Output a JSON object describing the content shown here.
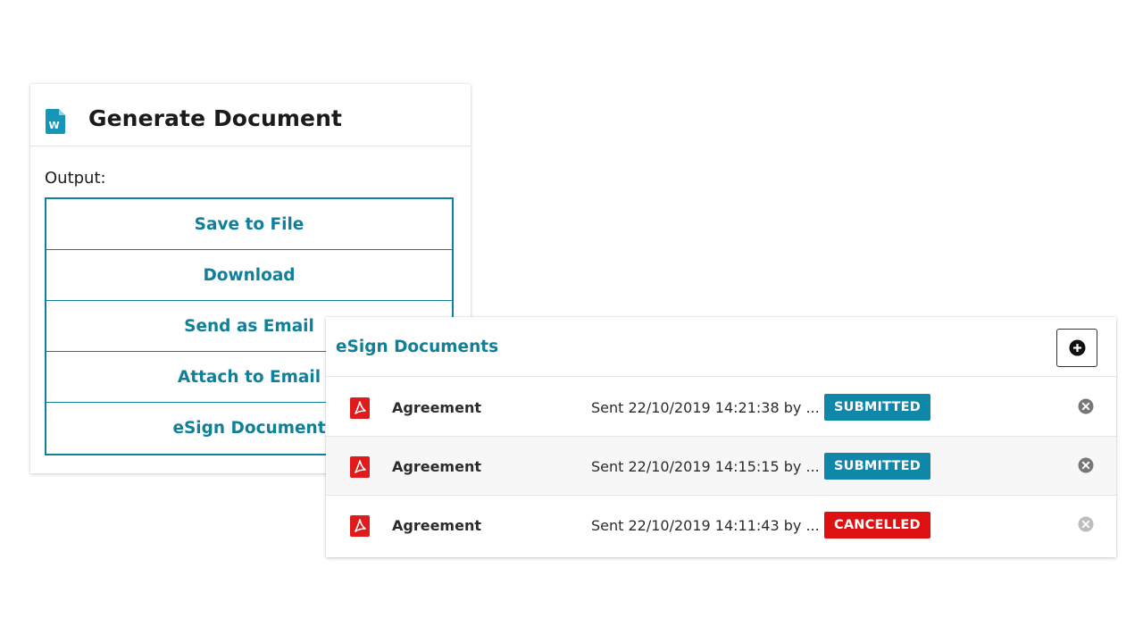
{
  "generate_panel": {
    "title": "Generate Document",
    "icon": "word-document-icon",
    "output_label": "Output:",
    "options": [
      {
        "name": "save-to-file-button",
        "label": "Save to File"
      },
      {
        "name": "download-button",
        "label": "Download"
      },
      {
        "name": "send-as-email-button",
        "label": "Send as Email"
      },
      {
        "name": "attach-to-email-button",
        "label": "Attach to Email"
      },
      {
        "name": "esign-document-button",
        "label": "eSign Document"
      }
    ]
  },
  "esign_panel": {
    "title": "eSign Documents",
    "add_icon": "plus-circle-icon",
    "rows": [
      {
        "name": "Agreement",
        "sent": "Sent 22/10/2019 14:21:38 by ...",
        "status": "SUBMITTED",
        "status_color": "#0f87a8",
        "remove_color": "#777777"
      },
      {
        "name": "Agreement",
        "sent": "Sent 22/10/2019 14:15:15 by ...",
        "status": "SUBMITTED",
        "status_color": "#0f87a8",
        "remove_color": "#777777"
      },
      {
        "name": "Agreement",
        "sent": "Sent 22/10/2019 14:11:43 by ...",
        "status": "CANCELLED",
        "status_color": "#dd1111",
        "remove_color": "#bdbdbd"
      }
    ]
  },
  "colors": {
    "accent": "#0f7f9a",
    "pdf_red": "#e01b1b"
  }
}
